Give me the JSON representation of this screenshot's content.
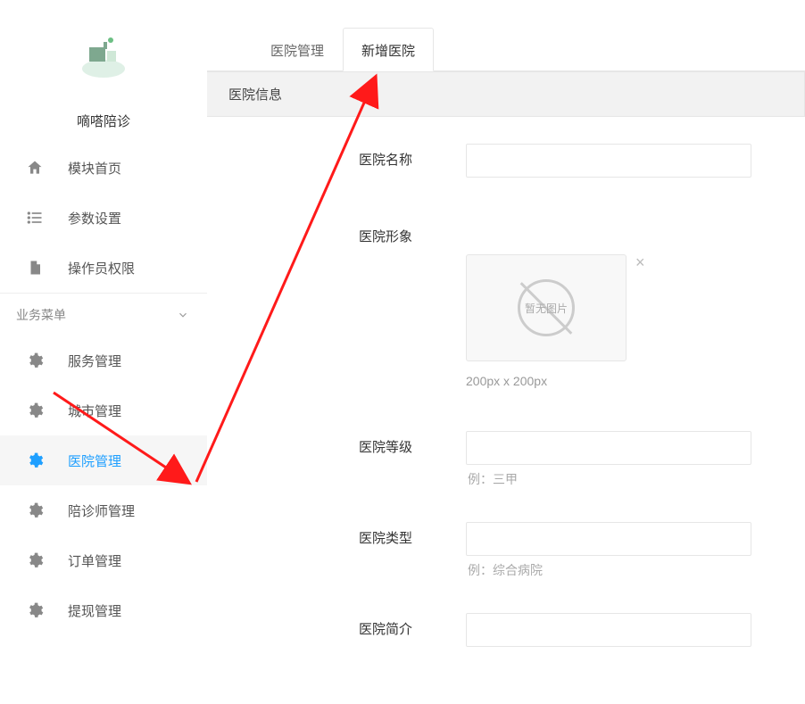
{
  "brand": "嘀嗒陪诊",
  "sidebar": {
    "top": [
      {
        "icon": "home",
        "label": "模块首页"
      },
      {
        "icon": "list",
        "label": "参数设置"
      },
      {
        "icon": "doc",
        "label": "操作员权限"
      }
    ],
    "section_label": "业务菜单",
    "biz": [
      {
        "label": "服务管理",
        "active": false
      },
      {
        "label": "城市管理",
        "active": false
      },
      {
        "label": "医院管理",
        "active": true
      },
      {
        "label": "陪诊师管理",
        "active": false
      },
      {
        "label": "订单管理",
        "active": false
      },
      {
        "label": "提现管理",
        "active": false
      }
    ]
  },
  "tabs": [
    {
      "label": "医院管理",
      "active": false
    },
    {
      "label": "新增医院",
      "active": true
    }
  ],
  "panel_title": "医院信息",
  "form": {
    "name_label": "医院名称",
    "image_label": "医院形象",
    "image_placeholder_text": "暂无图片",
    "image_hint": "200px x 200px",
    "level_label": "医院等级",
    "level_hint": "例：三甲",
    "type_label": "医院类型",
    "type_hint": "例：综合病院",
    "intro_label": "医院简介"
  }
}
